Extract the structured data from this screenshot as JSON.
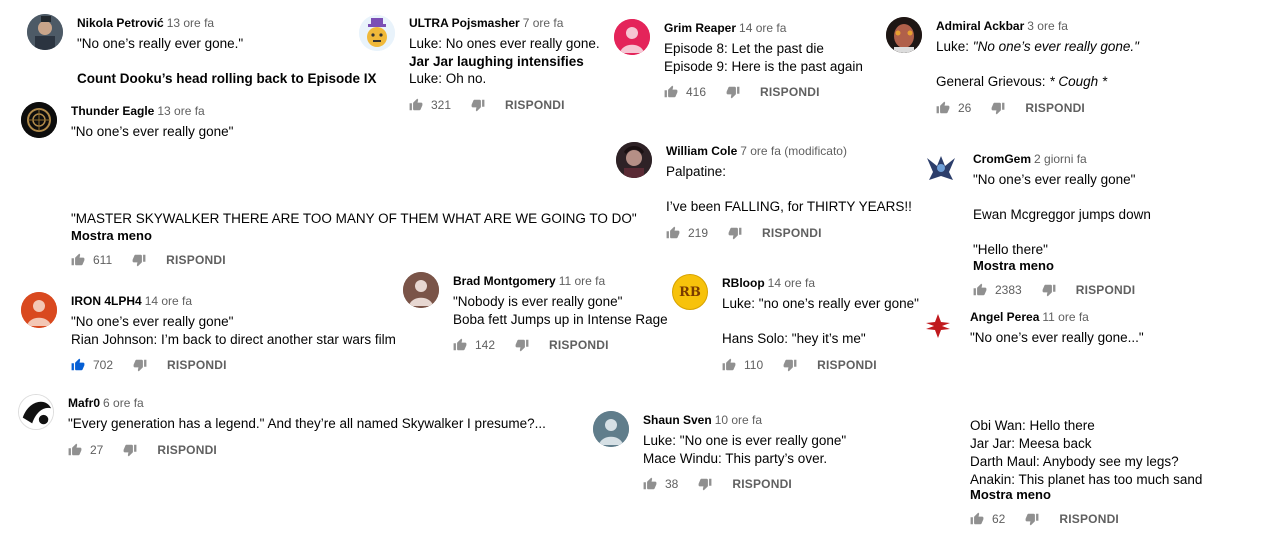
{
  "colors": {
    "text": "#030303",
    "secondary": "#606060",
    "accent": "#065fd4",
    "icon": "#909090"
  },
  "reply_label": "RISPONDI",
  "more_label": "Mostra meno",
  "comments": [
    {
      "author": "Nikola Petrović",
      "time": "13 ore fa",
      "lines": [
        "\"No one’s really ever gone.\"",
        "Count Dooku’s head rolling back to Episode IX"
      ]
    },
    {
      "author": "Thunder Eagle",
      "time": "13 ore fa",
      "lines": [
        "\"No one’s ever really gone\"",
        "\"MASTER SKYWALKER THERE ARE TOO MANY OF THEM WHAT ARE WE GOING TO DO\""
      ],
      "likes": "611"
    },
    {
      "author": "IRON 4LPH4",
      "time": "14 ore fa",
      "lines": [
        "\"No one’s ever really gone\"",
        "Rian Johnson: I’m back to direct another star wars film"
      ],
      "likes": "702",
      "liked": true
    },
    {
      "author": "Mafr0",
      "time": "6 ore fa",
      "lines": [
        "\"Every generation has a legend.\" And they’re all named Skywalker I presume?..."
      ],
      "likes": "27"
    },
    {
      "author": "ULTRA Pojsmasher",
      "time": "7 ore fa",
      "lines": [
        "Luke: No ones ever really gone.",
        "Jar Jar laughing intensifies",
        "Luke: Oh no."
      ],
      "likes": "321"
    },
    {
      "author": "Brad Montgomery",
      "time": "11 ore fa",
      "lines": [
        "\"Nobody is ever really gone\"",
        "Boba fett Jumps up in Intense Rage"
      ],
      "likes": "142"
    },
    {
      "author": "Grim Reaper",
      "time": "14 ore fa",
      "lines": [
        "Episode 8: Let the past die",
        "Episode 9: Here is the past again"
      ],
      "likes": "416"
    },
    {
      "author": "William Cole",
      "time": "7 ore fa (modificato)",
      "lines": [
        "Palpatine:",
        "I’ve been FALLING, for THIRTY YEARS!!"
      ],
      "likes": "219"
    },
    {
      "author": "RBloop",
      "time": "14 ore fa",
      "lines": [
        "Luke: \"no one’s really ever gone\"",
        "Hans Solo: \"hey it’s me\""
      ],
      "likes": "110",
      "avatar_text": "RB"
    },
    {
      "author": "Shaun Sven",
      "time": "10 ore fa",
      "lines": [
        "Luke: \"No one is ever really gone\"",
        "Mace Windu: This party’s over."
      ],
      "likes": "38"
    },
    {
      "author": "Admiral Ackbar",
      "time": "3 ore fa",
      "lines": [
        "Luke: ",
        "\"No one’s ever really gone.\"",
        "General Grievous: ",
        "* Cough *"
      ],
      "likes": "26"
    },
    {
      "author": "CromGem",
      "time": "2 giorni fa",
      "lines": [
        "\"No one’s ever really gone\"",
        "Ewan Mcgreggor jumps down",
        "\"Hello there\""
      ],
      "likes": "2383"
    },
    {
      "author": "Angel Perea",
      "time": "11 ore fa",
      "lines": [
        "\"No one’s ever really gone...\"",
        "Obi Wan: Hello there",
        "Jar Jar: Meesa back",
        "Darth Maul: Anybody see my legs?",
        "Anakin: This planet has too much sand"
      ],
      "likes": "62"
    }
  ]
}
